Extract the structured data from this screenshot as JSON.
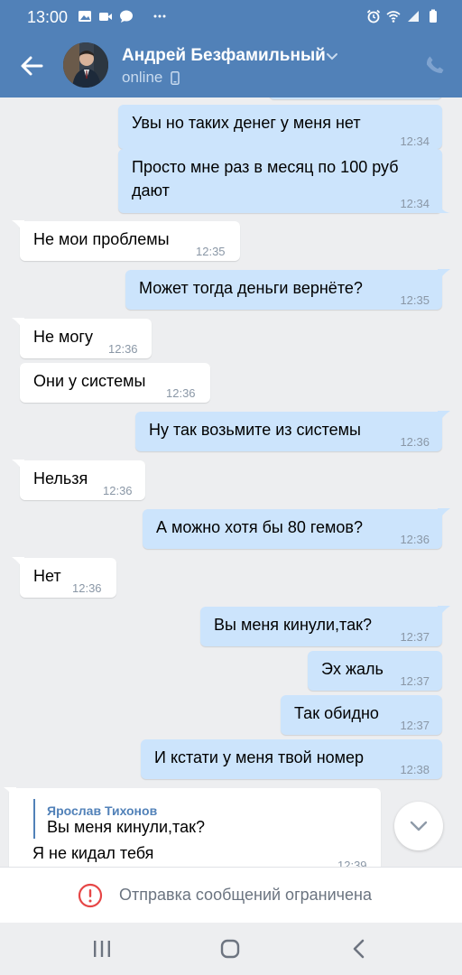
{
  "status_bar": {
    "time": "13:00",
    "left_icons": [
      "image-icon",
      "video-icon",
      "chat-icon",
      "more-dots-icon"
    ],
    "right_icons": [
      "alarm-icon",
      "wifi-icon",
      "signal-icon",
      "battery-icon"
    ]
  },
  "header": {
    "contact_name": "Андрей Безфамильный",
    "presence": "online",
    "colors": {
      "bar": "#5181b8"
    }
  },
  "messages": [
    {
      "dir": "out",
      "text": "Увы но таких денег у меня нет",
      "time": "12:34"
    },
    {
      "dir": "out",
      "text": "Просто мне раз в месяц по 100 руб",
      "text2": "дают",
      "time": "12:34"
    },
    {
      "dir": "in",
      "text": "Не мои проблемы",
      "time": "12:35"
    },
    {
      "dir": "out",
      "text": "Может тогда деньги вернёте?",
      "time": "12:35"
    },
    {
      "dir": "in",
      "text": "Не могу",
      "time": "12:36"
    },
    {
      "dir": "in",
      "text": "Они у системы",
      "time": "12:36"
    },
    {
      "dir": "out",
      "text": "Ну так возьмите из системы",
      "time": "12:36"
    },
    {
      "dir": "in",
      "text": "Нельзя",
      "time": "12:36"
    },
    {
      "dir": "out",
      "text": "А можно хотя бы 80 гемов?",
      "time": "12:36"
    },
    {
      "dir": "in",
      "text": "Нет",
      "time": "12:36"
    },
    {
      "dir": "out",
      "text": "Вы меня кинули,так?",
      "time": "12:37"
    },
    {
      "dir": "out",
      "text": "Эх жаль",
      "time": "12:37"
    },
    {
      "dir": "out",
      "text": "Так обидно",
      "time": "12:37"
    },
    {
      "dir": "out",
      "text": "И кстати у меня твой номер",
      "time": "12:38"
    },
    {
      "dir": "in",
      "reply_author": "Ярослав Тихонов",
      "reply_text": "Вы меня кинули,так?",
      "text": "Я не кидал тебя",
      "time": "12:39"
    }
  ],
  "restriction": {
    "text": "Отправка сообщений ограничена",
    "icon": "alert-circle-icon",
    "icon_color": "#e64646"
  },
  "colors": {
    "background": "#edeef0",
    "outgoing_bubble": "#cce4fc",
    "incoming_bubble": "#ffffff",
    "reply_author": "#5181b8"
  },
  "nav": [
    "recent-apps-icon",
    "home-icon",
    "back-icon"
  ]
}
